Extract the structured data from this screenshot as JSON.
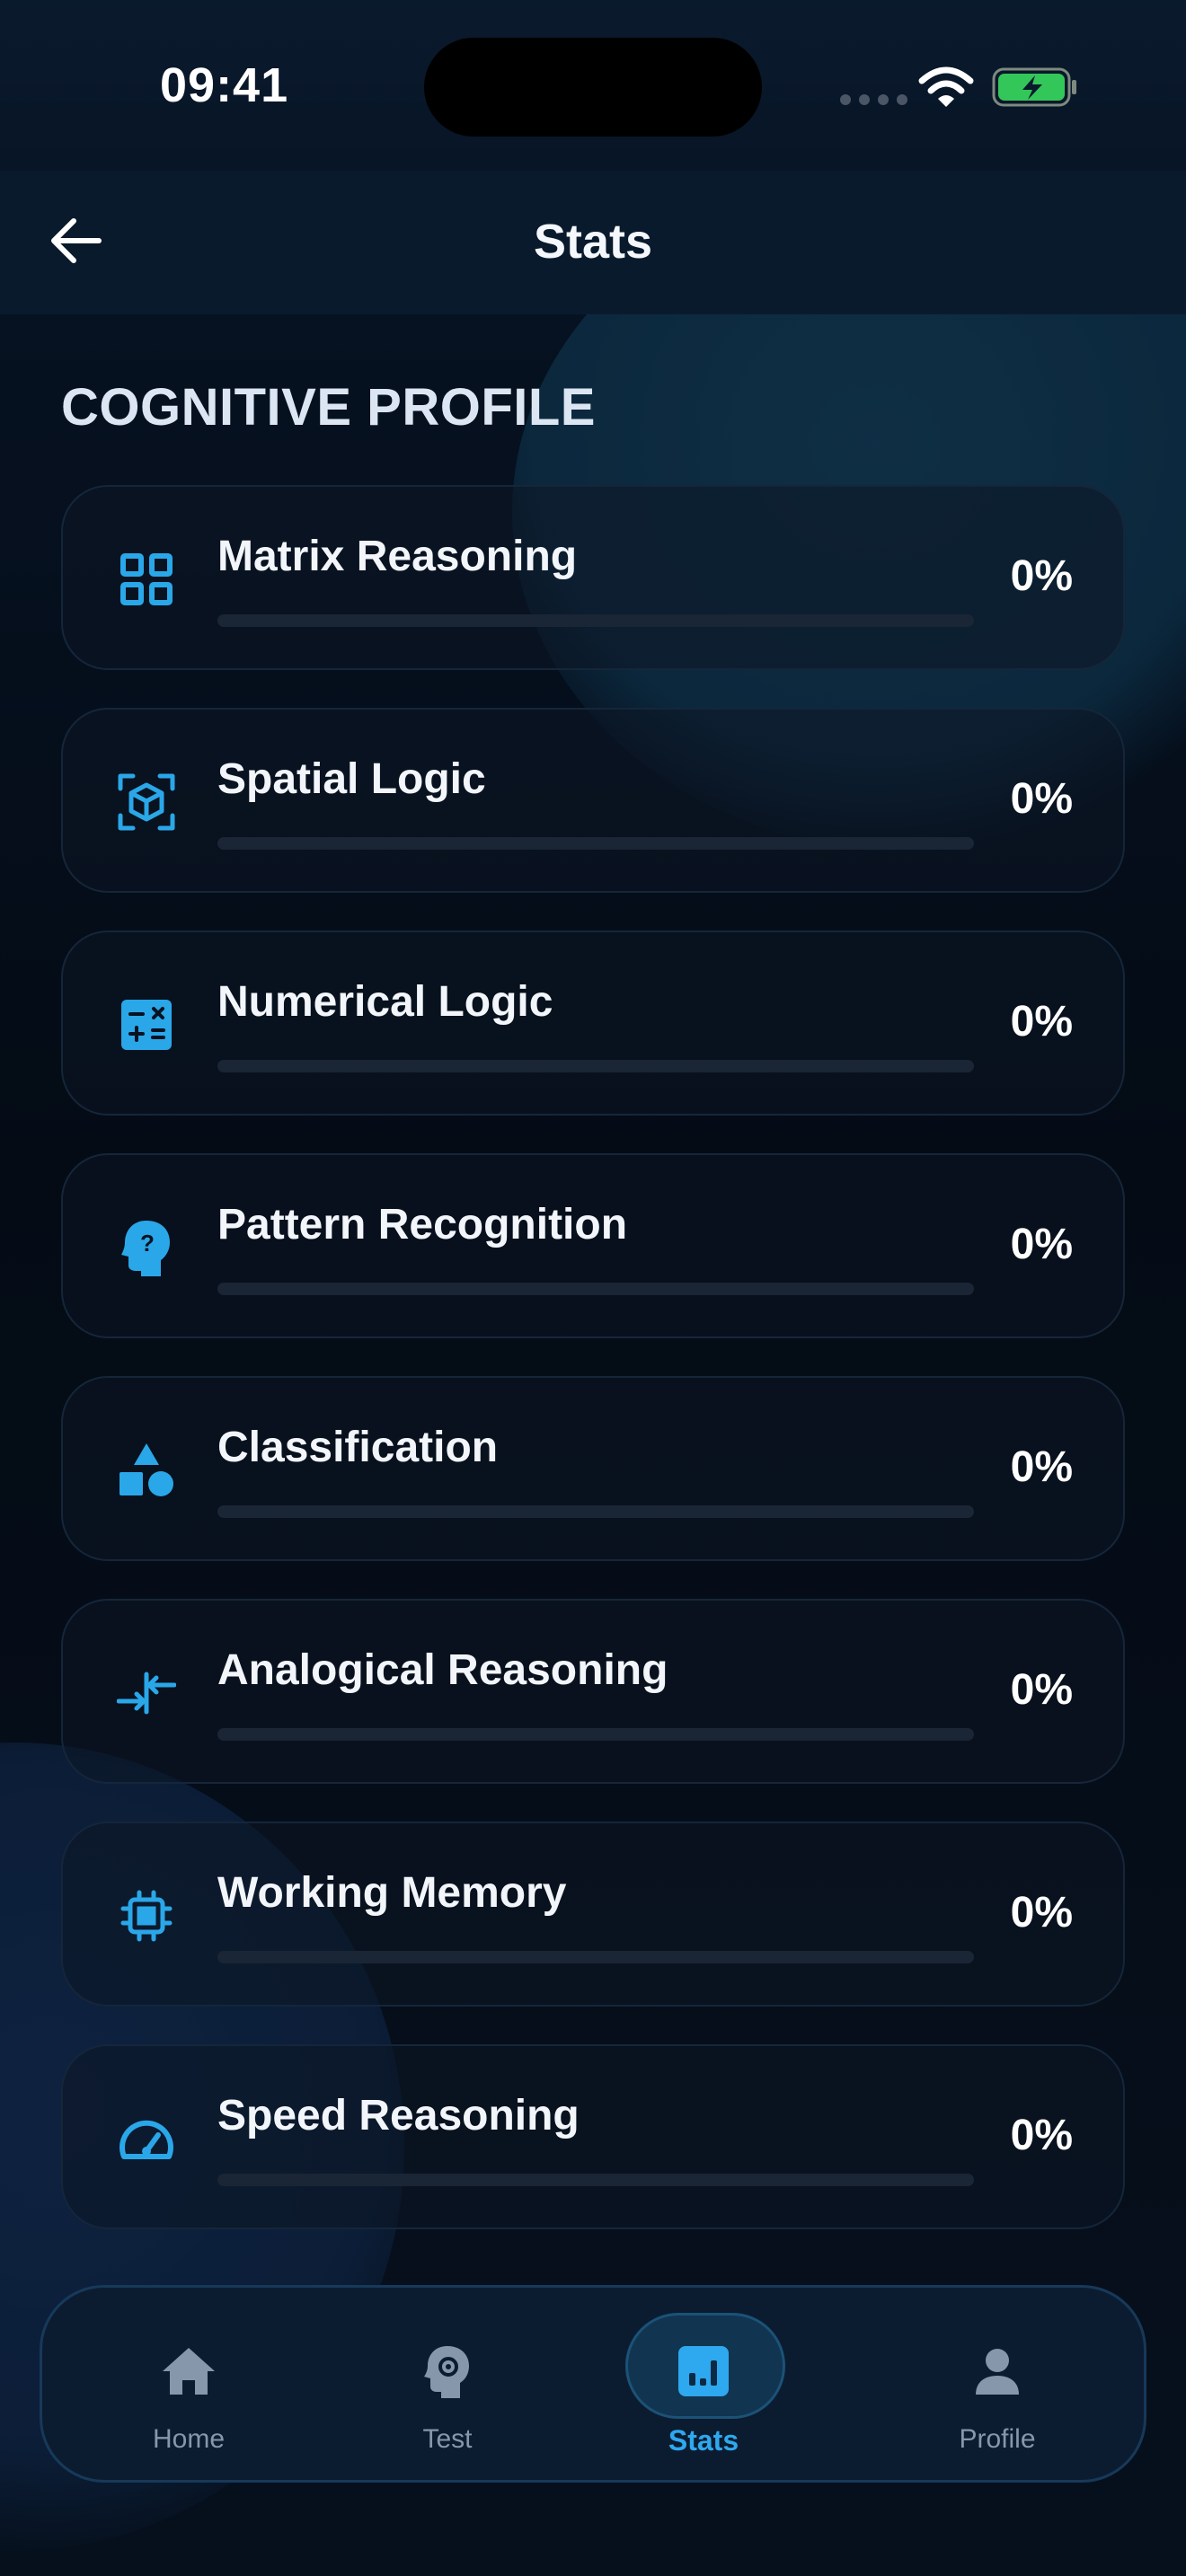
{
  "status_bar": {
    "time": "09:41"
  },
  "header": {
    "title": "Stats"
  },
  "section": {
    "title": "COGNITIVE PROFILE"
  },
  "colors": {
    "accent": "#2aa7e8",
    "battery": "#33c759"
  },
  "categories": [
    {
      "label": "Matrix Reasoning",
      "value": "0%",
      "progress": 0,
      "icon": "grid-icon"
    },
    {
      "label": "Spatial Logic",
      "value": "0%",
      "progress": 0,
      "icon": "cube-scan-icon"
    },
    {
      "label": "Numerical Logic",
      "value": "0%",
      "progress": 0,
      "icon": "calculator-icon"
    },
    {
      "label": "Pattern Recognition",
      "value": "0%",
      "progress": 0,
      "icon": "head-question-icon"
    },
    {
      "label": "Classification",
      "value": "0%",
      "progress": 0,
      "icon": "shapes-icon"
    },
    {
      "label": "Analogical Reasoning",
      "value": "0%",
      "progress": 0,
      "icon": "compare-arrows-icon"
    },
    {
      "label": "Working Memory",
      "value": "0%",
      "progress": 0,
      "icon": "chip-icon"
    },
    {
      "label": "Speed Reasoning",
      "value": "0%",
      "progress": 0,
      "icon": "speedometer-icon"
    }
  ],
  "nav": {
    "items": [
      {
        "label": "Home",
        "icon": "home-icon"
      },
      {
        "label": "Test",
        "icon": "head-gear-icon"
      },
      {
        "label": "Stats",
        "icon": "bar-chart-icon",
        "active": true
      },
      {
        "label": "Profile",
        "icon": "person-icon"
      }
    ]
  }
}
